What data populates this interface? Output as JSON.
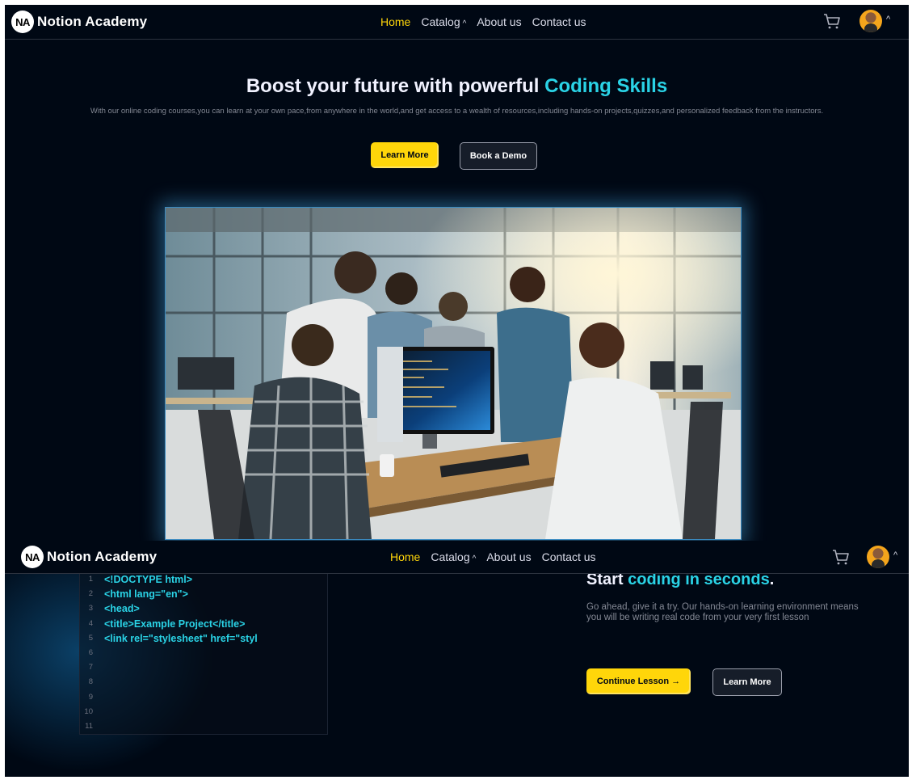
{
  "brand": {
    "badge": "NA",
    "name": "Notion Academy"
  },
  "nav": {
    "links": [
      {
        "label": "Home",
        "active": true
      },
      {
        "label": "Catalog",
        "dropdown": true
      },
      {
        "label": "About us"
      },
      {
        "label": "Contact us"
      }
    ],
    "cart_icon": "cart-icon",
    "profile_icon": "user-avatar"
  },
  "hero": {
    "title_prefix": "Boost your future with powerful ",
    "title_highlight": "Coding Skills",
    "subtitle": "With our online coding courses,you can learn at your own pace,from anywhere in the world,and get access to a wealth of resources,including hands-on projects,quizzes,and personalized feedback from the instructors.",
    "primary_button": "Learn More",
    "secondary_button": "Book a Demo"
  },
  "code_section": {
    "title_prefix": "Start ",
    "title_highlight": "coding in seconds",
    "title_suffix": ".",
    "description": "Go ahead, give it a try. Our hands-on learning environment means you will be writing real code from your very first lesson",
    "primary_button": "Continue Lesson →",
    "secondary_button": "Learn More",
    "code_lines": [
      {
        "num": "1",
        "text": "<!DOCTYPE html>"
      },
      {
        "num": "2",
        "text": "<html lang=\"en\">"
      },
      {
        "num": "3",
        "text": "<head>"
      },
      {
        "num": "4",
        "text": "<title>Example Project</title>"
      },
      {
        "num": "5",
        "text": "<link rel=\"stylesheet\" href=\"styl"
      },
      {
        "num": "6",
        "text": ""
      },
      {
        "num": "7",
        "text": ""
      },
      {
        "num": "8",
        "text": ""
      },
      {
        "num": "9",
        "text": ""
      },
      {
        "num": "10",
        "text": ""
      },
      {
        "num": "11",
        "text": ""
      }
    ]
  },
  "colors": {
    "background": "#000814",
    "accent": "#ffd60a",
    "highlight": "#2ad3e6"
  }
}
